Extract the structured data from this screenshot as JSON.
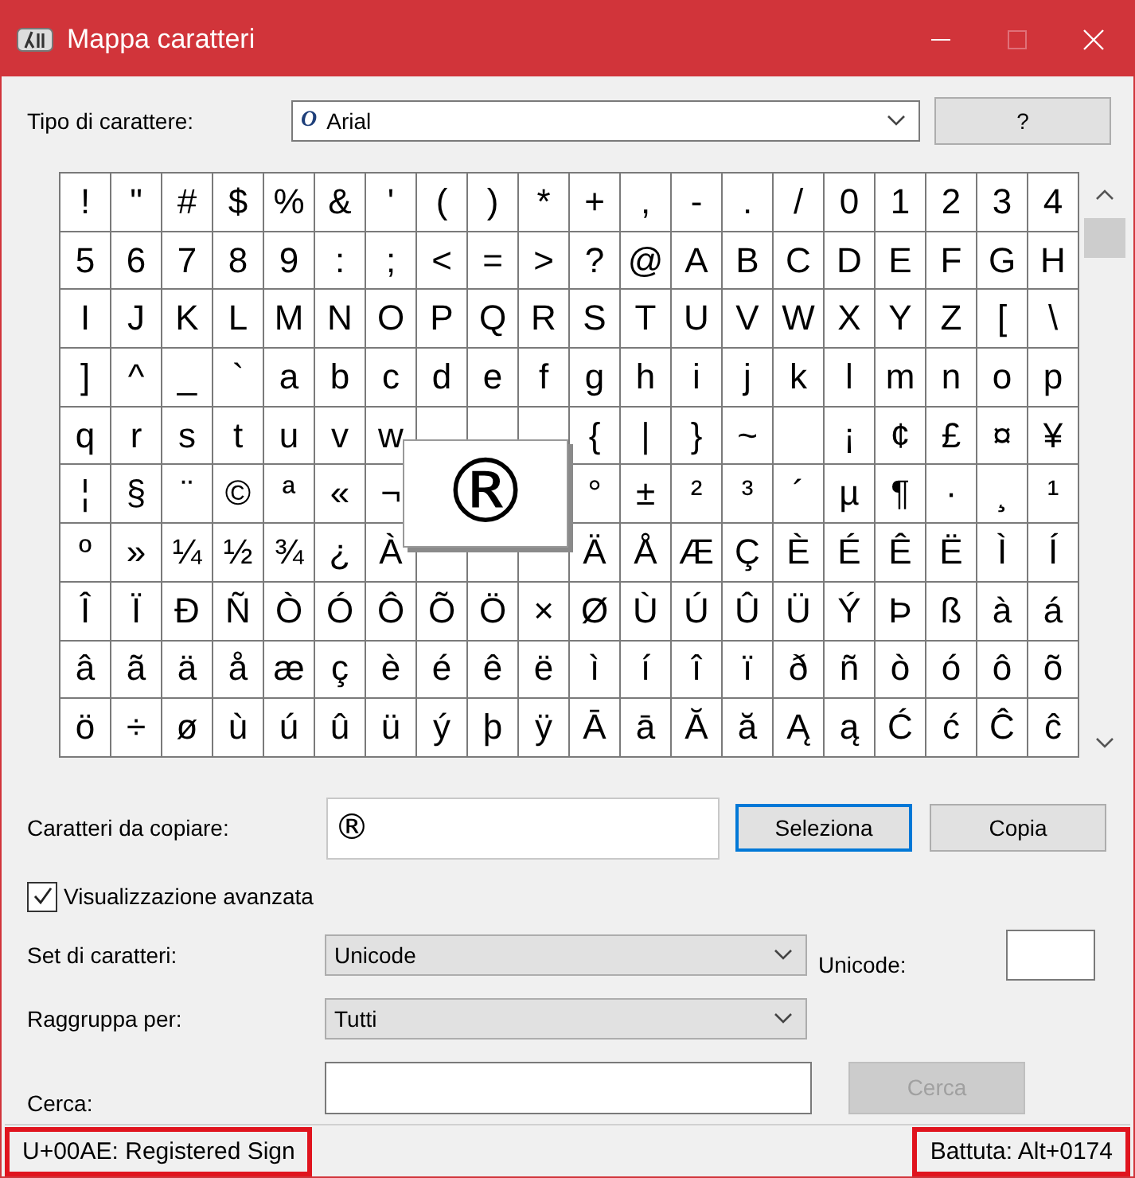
{
  "window": {
    "title": "Mappa caratteri"
  },
  "font": {
    "label": "Tipo di carattere:",
    "type_icon": "O",
    "value": "Arial"
  },
  "help_button": "?",
  "grid": {
    "rows": [
      [
        "!",
        "\"",
        "#",
        "$",
        "%",
        "&",
        "'",
        "(",
        ")",
        "*",
        "+",
        ",",
        "-",
        ".",
        "/",
        "0",
        "1",
        "2",
        "3",
        "4"
      ],
      [
        "5",
        "6",
        "7",
        "8",
        "9",
        ":",
        ";",
        "<",
        "=",
        ">",
        "?",
        "@",
        "A",
        "B",
        "C",
        "D",
        "E",
        "F",
        "G",
        "H"
      ],
      [
        "I",
        "J",
        "K",
        "L",
        "M",
        "N",
        "O",
        "P",
        "Q",
        "R",
        "S",
        "T",
        "U",
        "V",
        "W",
        "X",
        "Y",
        "Z",
        "[",
        "\\"
      ],
      [
        "]",
        "^",
        "_",
        "`",
        "a",
        "b",
        "c",
        "d",
        "e",
        "f",
        "g",
        "h",
        "i",
        "j",
        "k",
        "l",
        "m",
        "n",
        "o",
        "p"
      ],
      [
        "q",
        "r",
        "s",
        "t",
        "u",
        "v",
        "w",
        null,
        null,
        null,
        "{",
        "|",
        "}",
        "~",
        null,
        "¡",
        "¢",
        "£",
        "¤",
        "¥"
      ],
      [
        "¦",
        "§",
        "¨",
        "©",
        "ª",
        "«",
        "¬",
        null,
        null,
        null,
        "°",
        "±",
        "²",
        "³",
        "´",
        "µ",
        "¶",
        "·",
        "¸",
        "¹"
      ],
      [
        "º",
        "»",
        "¼",
        "½",
        "¾",
        "¿",
        "À",
        null,
        null,
        null,
        "Ä",
        "Å",
        "Æ",
        "Ç",
        "È",
        "É",
        "Ê",
        "Ë",
        "Ì",
        "Í"
      ],
      [
        "Î",
        "Ï",
        "Ð",
        "Ñ",
        "Ò",
        "Ó",
        "Ô",
        "Õ",
        "Ö",
        "×",
        "Ø",
        "Ù",
        "Ú",
        "Û",
        "Ü",
        "Ý",
        "Þ",
        "ß",
        "à",
        "á"
      ],
      [
        "â",
        "ã",
        "ä",
        "å",
        "æ",
        "ç",
        "è",
        "é",
        "ê",
        "ë",
        "ì",
        "í",
        "î",
        "ï",
        "ð",
        "ñ",
        "ò",
        "ó",
        "ô",
        "õ"
      ],
      [
        "ö",
        "÷",
        "ø",
        "ù",
        "ú",
        "û",
        "ü",
        "ý",
        "þ",
        "ÿ",
        "Ā",
        "ā",
        "Ă",
        "ă",
        "Ą",
        "ą",
        "Ć",
        "ć",
        "Ĉ",
        "ĉ"
      ]
    ],
    "enlarged": "®"
  },
  "copy": {
    "label": "Caratteri da copiare:",
    "value": "®",
    "select_button": {
      "label": "Seleziona",
      "focused": true
    },
    "copy_button": {
      "label": "Copia",
      "focused": false
    }
  },
  "advanced": {
    "label": "Visualizzazione avanzata",
    "checked": true
  },
  "charset": {
    "label": "Set di caratteri:",
    "value": "Unicode"
  },
  "unicode": {
    "label": "Unicode:"
  },
  "group_by": {
    "label": "Raggruppa per:",
    "value": "Tutti"
  },
  "search": {
    "label": "Cerca:",
    "button": "Cerca",
    "button_disabled": true
  },
  "status_bar": {
    "character": "U+00AE: Registered Sign",
    "keystroke": "Battuta: Alt+0174"
  }
}
